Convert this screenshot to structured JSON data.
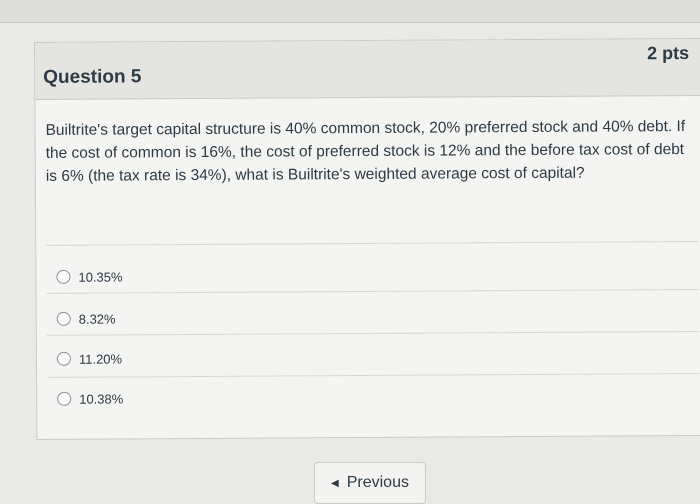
{
  "question": {
    "title": "Question 5",
    "points": "2 pts",
    "text": "Builtrite's target capital structure is 40% common stock, 20% preferred stock and 40% debt. If the cost of common is 16%, the cost of preferred stock is 12% and the before tax cost of debt is 6% (the tax rate is 34%), what is Builtrite's weighted average cost of capital?",
    "answers": [
      {
        "label": "10.35%"
      },
      {
        "label": "8.32%"
      },
      {
        "label": "11.20%"
      },
      {
        "label": "10.38%"
      }
    ]
  },
  "navigation": {
    "previous_label": "Previous",
    "previous_icon": "chevron-left-icon"
  },
  "icons": {
    "collapse": "chevron-right-icon"
  }
}
